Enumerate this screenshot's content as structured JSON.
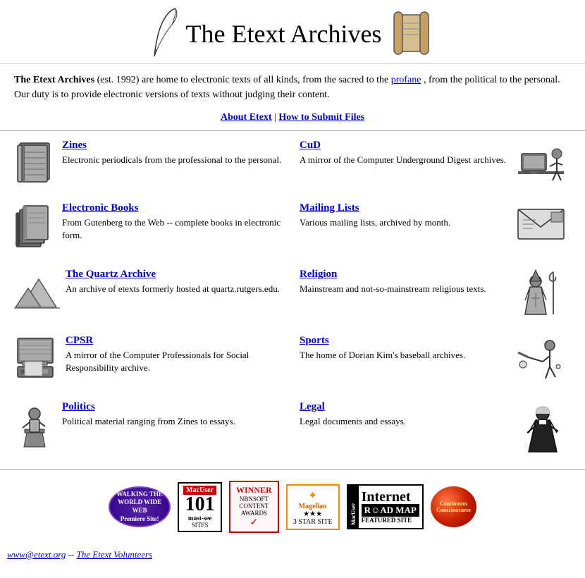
{
  "header": {
    "title": "The Etext Archives",
    "icon_left_label": "quill-icon",
    "icon_right_label": "scroll-icon"
  },
  "intro": {
    "site_name": "The Etext Archives",
    "established": "est. 1992",
    "description_before": " are home to electronic texts of all kinds, from the sacred to the ",
    "profane": "profane",
    "description_middle": ", from the political to the personal. Our duty is to provide electronic versions of texts without judging their content."
  },
  "nav": {
    "about_label": "About Etext",
    "about_href": "#",
    "submit_label": "How to Submit Files",
    "submit_href": "#"
  },
  "sections": [
    {
      "id": "zines",
      "title": "Zines",
      "description": "Electronic periodicals from the professional to the personal.",
      "href": "#",
      "icon": "book-stack-icon"
    },
    {
      "id": "cud",
      "title": "CuD",
      "description": "A mirror of the Computer Underground Digest archives.",
      "href": "#",
      "icon": "computer-person-icon"
    },
    {
      "id": "electronic-books",
      "title": "Electronic Books",
      "description": "From Gutenberg to the Web -- complete books in electronic form.",
      "href": "#",
      "icon": "books-icon"
    },
    {
      "id": "mailing-lists",
      "title": "Mailing Lists",
      "description": "Various mailing lists, archived by month.",
      "href": "#",
      "icon": "envelope-icon"
    },
    {
      "id": "quartz-archive",
      "title": "The Quartz Archive",
      "description": "An archive of etexts formerly hosted at quartz.rutgers.edu.",
      "href": "#",
      "icon": "pyramids-icon"
    },
    {
      "id": "religion",
      "title": "Religion",
      "description": "Mainstream and not-so-mainstream religious texts.",
      "href": "#",
      "icon": "bishop-icon"
    },
    {
      "id": "cpsr",
      "title": "CPSR",
      "description": "A mirror of the Computer Professionals for Social Responsibility archive.",
      "href": "#",
      "icon": "computer-desk-icon"
    },
    {
      "id": "sports",
      "title": "Sports",
      "description": "The home of Dorian Kim's baseball archives.",
      "href": "#",
      "icon": "sports-icon"
    },
    {
      "id": "politics",
      "title": "Politics",
      "description": "Political material ranging from Zines to essays.",
      "href": "#",
      "icon": "speaker-icon"
    },
    {
      "id": "legal",
      "title": "Legal",
      "description": "Legal documents and essays.",
      "href": "#",
      "icon": "judge-icon"
    }
  ],
  "footer": {
    "email": "www@etext.org",
    "email_href": "mailto:www@etext.org",
    "volunteers_label": "The Etext Volunteers",
    "volunteers_href": "#",
    "badges": [
      {
        "id": "walking-www",
        "label": "Walking the World Wide Web Premiere Site!"
      },
      {
        "id": "macuser-101",
        "label": "MacUser 101 Must-See Sites"
      },
      {
        "id": "winner",
        "label": "Winner NBNSOFT Content Awards"
      },
      {
        "id": "magellan",
        "label": "Magellan 3 Star Site"
      },
      {
        "id": "internet-roadmap",
        "label": "MacUser Internet Road Map Featured Site"
      },
      {
        "id": "globe",
        "label": "Continuum Consciousness"
      }
    ]
  }
}
